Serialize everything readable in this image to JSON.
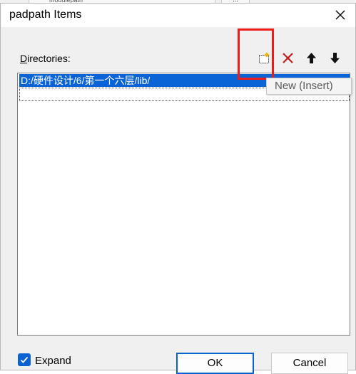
{
  "background_window": {
    "tab_label": "modulepath",
    "more_label": "..."
  },
  "dialog": {
    "title": "padpath Items"
  },
  "directories": {
    "label_prefix": "",
    "label_accel": "D",
    "label_rest": "irectories:",
    "items": [
      "D:/硬件设计/6/第一个六层/lib/"
    ]
  },
  "toolbar": {
    "new_icon": "new-folder-icon",
    "delete_icon": "delete-x-icon",
    "move_up_icon": "arrow-up-icon",
    "move_down_icon": "arrow-down-icon",
    "tooltip": "New (Insert)"
  },
  "footer": {
    "expand_label": "Expand",
    "expand_checked": true,
    "ok_label": "OK",
    "cancel_label": "Cancel"
  },
  "colors": {
    "selection": "#0a64d6",
    "accent": "#0b63d2",
    "highlight": "#ef1b1b"
  }
}
